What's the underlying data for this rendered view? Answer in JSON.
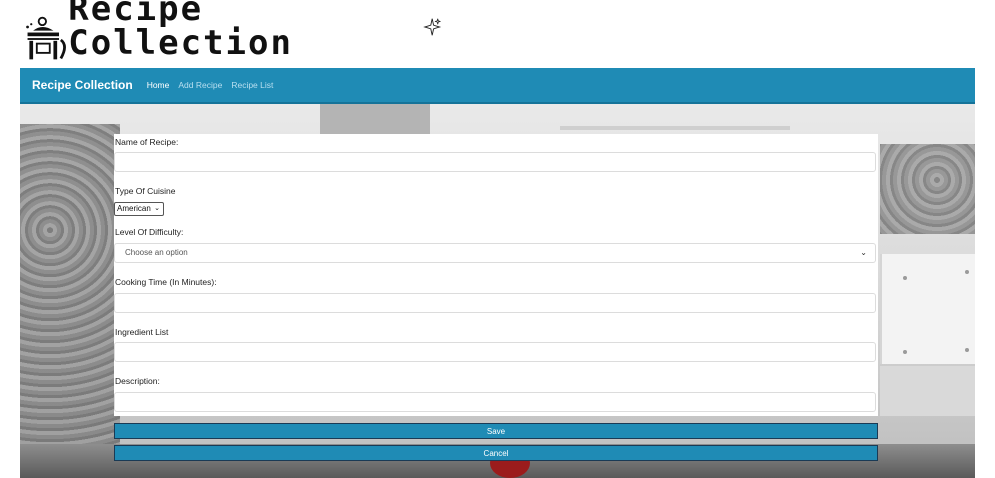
{
  "logo": {
    "title": "Recipe Collection",
    "icon": "chef-icon"
  },
  "navbar": {
    "brand": "Recipe Collection",
    "links": [
      {
        "label": "Home",
        "active": true
      },
      {
        "label": "Add Recipe",
        "active": false
      },
      {
        "label": "Recipe List",
        "active": false
      }
    ]
  },
  "form": {
    "name_label": "Name of Recipe:",
    "name_value": "",
    "cuisine_label": "Type Of Cuisine",
    "cuisine_value": "American",
    "difficulty_label": "Level Of Difficulty:",
    "difficulty_value": "Choose an option",
    "time_label": "Cooking Time (In Minutes):",
    "time_value": "",
    "ingredients_label": "Ingredient List",
    "ingredients_value": "",
    "description_label": "Description:",
    "description_value": ""
  },
  "buttons": {
    "save": "Save",
    "cancel": "Cancel"
  },
  "colors": {
    "primary": "#1f8bb5",
    "text": "#222222"
  }
}
